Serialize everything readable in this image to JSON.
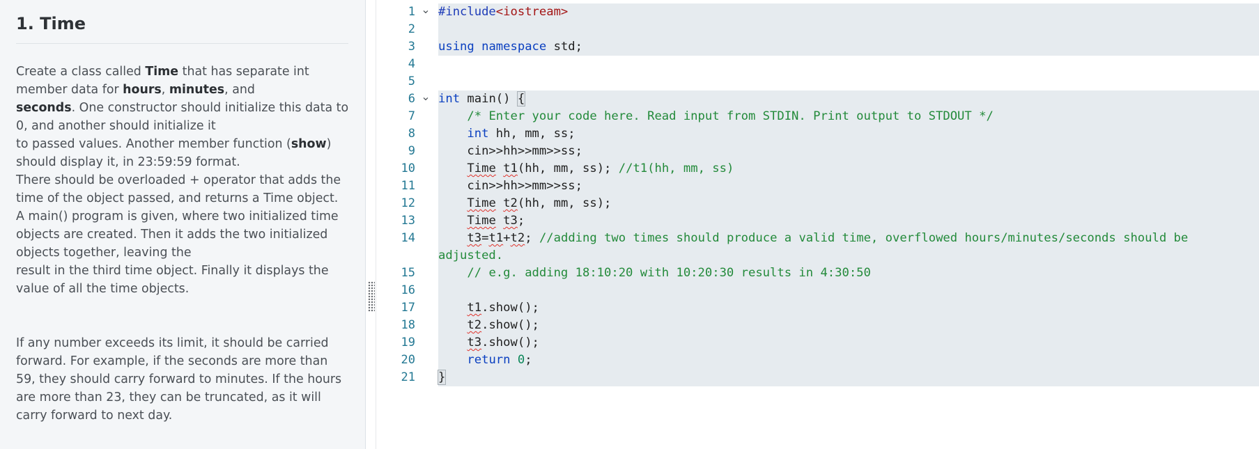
{
  "problem": {
    "title": "1. Time",
    "paragraphs": [
      [
        {
          "t": "Create a class called ",
          "b": false
        },
        {
          "t": "Time",
          "b": true
        },
        {
          "t": " that has separate int\nmember data for ",
          "b": false
        },
        {
          "t": "hours",
          "b": true
        },
        {
          "t": ", ",
          "b": false
        },
        {
          "t": "minutes",
          "b": true
        },
        {
          "t": ", and\n",
          "b": false
        },
        {
          "t": "seconds",
          "b": true
        },
        {
          "t": ". One constructor should initialize this data to\n0, and another should initialize it\nto passed values. Another member function (",
          "b": false
        },
        {
          "t": "show",
          "b": true
        },
        {
          "t": ")\nshould display it, in 23:59:59 format.",
          "b": false
        }
      ],
      [
        {
          "t": "There should be overloaded + operator that adds the\ntime of the object passed, and returns a Time object.",
          "b": false
        }
      ],
      [
        {
          "t": "A main() program is given, where two initialized time\nobjects are created. Then it adds the two initialized\nobjects together, leaving the\nresult in the third time object. Finally it displays the\nvalue of all the time objects.",
          "b": false
        }
      ],
      [
        {
          "t": "If any number exceeds its limit, it should be carried\nforward. For example, if the seconds are more than\n59, they should carry forward to minutes. If the hours\nare more than 23, they can be truncated, as it will\ncarry forward to next day.",
          "b": false
        }
      ]
    ]
  },
  "editor": {
    "fold_icon": "chevron-down-icon",
    "lines": [
      {
        "n": "1",
        "fold": true,
        "hl": true,
        "tokens": [
          [
            "pre",
            "#include"
          ],
          [
            "str",
            "<iostream>"
          ]
        ]
      },
      {
        "n": "2",
        "fold": false,
        "hl": true,
        "tokens": []
      },
      {
        "n": "3",
        "fold": false,
        "hl": true,
        "tokens": [
          [
            "kw",
            "using"
          ],
          [
            "txt",
            " "
          ],
          [
            "kw",
            "namespace"
          ],
          [
            "txt",
            " std;"
          ]
        ]
      },
      {
        "n": "4",
        "fold": false,
        "hl": false,
        "tokens": []
      },
      {
        "n": "5",
        "fold": false,
        "hl": false,
        "tokens": []
      },
      {
        "n": "6",
        "fold": true,
        "hl": true,
        "tokens": [
          [
            "kw",
            "int"
          ],
          [
            "txt",
            " main() "
          ],
          [
            "brace",
            "{"
          ]
        ]
      },
      {
        "n": "7",
        "fold": false,
        "hl": true,
        "tokens": [
          [
            "txt",
            "    "
          ],
          [
            "cm",
            "/* Enter your code here. Read input from STDIN. Print output to STDOUT */"
          ]
        ]
      },
      {
        "n": "8",
        "fold": false,
        "hl": true,
        "tokens": [
          [
            "txt",
            "    "
          ],
          [
            "kw",
            "int"
          ],
          [
            "txt",
            " hh, mm, ss;"
          ]
        ]
      },
      {
        "n": "9",
        "fold": false,
        "hl": true,
        "tokens": [
          [
            "txt",
            "    cin>>hh>>mm>>ss;"
          ]
        ]
      },
      {
        "n": "10",
        "fold": false,
        "hl": true,
        "tokens": [
          [
            "txt",
            "    "
          ],
          [
            "sq",
            "Time"
          ],
          [
            "txt",
            " "
          ],
          [
            "sq",
            "t1"
          ],
          [
            "txt",
            "(hh, mm, ss); "
          ],
          [
            "cm",
            "//t1(hh, mm, ss)"
          ]
        ]
      },
      {
        "n": "11",
        "fold": false,
        "hl": true,
        "tokens": [
          [
            "txt",
            "    cin>>hh>>mm>>ss;"
          ]
        ]
      },
      {
        "n": "12",
        "fold": false,
        "hl": true,
        "tokens": [
          [
            "txt",
            "    "
          ],
          [
            "sq",
            "Time"
          ],
          [
            "txt",
            " "
          ],
          [
            "sq",
            "t2"
          ],
          [
            "txt",
            "(hh, mm, ss);"
          ]
        ]
      },
      {
        "n": "13",
        "fold": false,
        "hl": true,
        "tokens": [
          [
            "txt",
            "    "
          ],
          [
            "sq",
            "Time"
          ],
          [
            "txt",
            " "
          ],
          [
            "sq",
            "t3"
          ],
          [
            "txt",
            ";"
          ]
        ]
      },
      {
        "n": "14",
        "fold": false,
        "hl": true,
        "tokens": [
          [
            "txt",
            "    "
          ],
          [
            "sq",
            "t3"
          ],
          [
            "txt",
            "="
          ],
          [
            "sq",
            "t1"
          ],
          [
            "txt",
            "+"
          ],
          [
            "sq",
            "t2"
          ],
          [
            "txt",
            "; "
          ],
          [
            "cm",
            "//adding two times should produce a valid time, overflowed hours/minutes/seconds should be"
          ]
        ]
      },
      {
        "n": "",
        "fold": false,
        "hl": true,
        "tokens": [
          [
            "cm",
            "adjusted."
          ]
        ]
      },
      {
        "n": "15",
        "fold": false,
        "hl": true,
        "tokens": [
          [
            "txt",
            "    "
          ],
          [
            "cm",
            "// e.g. adding 18:10:20 with 10:20:30 results in 4:30:50"
          ]
        ]
      },
      {
        "n": "16",
        "fold": false,
        "hl": true,
        "tokens": []
      },
      {
        "n": "17",
        "fold": false,
        "hl": true,
        "tokens": [
          [
            "txt",
            "    "
          ],
          [
            "sq",
            "t1"
          ],
          [
            "txt",
            ".show();"
          ]
        ]
      },
      {
        "n": "18",
        "fold": false,
        "hl": true,
        "tokens": [
          [
            "txt",
            "    "
          ],
          [
            "sq",
            "t2"
          ],
          [
            "txt",
            ".show();"
          ]
        ]
      },
      {
        "n": "19",
        "fold": false,
        "hl": true,
        "tokens": [
          [
            "txt",
            "    "
          ],
          [
            "sq",
            "t3"
          ],
          [
            "txt",
            ".show();"
          ]
        ]
      },
      {
        "n": "20",
        "fold": false,
        "hl": true,
        "tokens": [
          [
            "txt",
            "    "
          ],
          [
            "kw",
            "return"
          ],
          [
            "txt",
            " "
          ],
          [
            "num",
            "0"
          ],
          [
            "txt",
            ";"
          ]
        ]
      },
      {
        "n": "21",
        "fold": false,
        "hl": true,
        "tokens": [
          [
            "brace",
            "}"
          ]
        ]
      }
    ]
  },
  "colors": {
    "panel_bg": "#f4f6f8",
    "keyword": "#0a3fc0",
    "string": "#a31515",
    "comment": "#238a3a",
    "line_number": "#237893",
    "highlight": "#e6ebef"
  }
}
